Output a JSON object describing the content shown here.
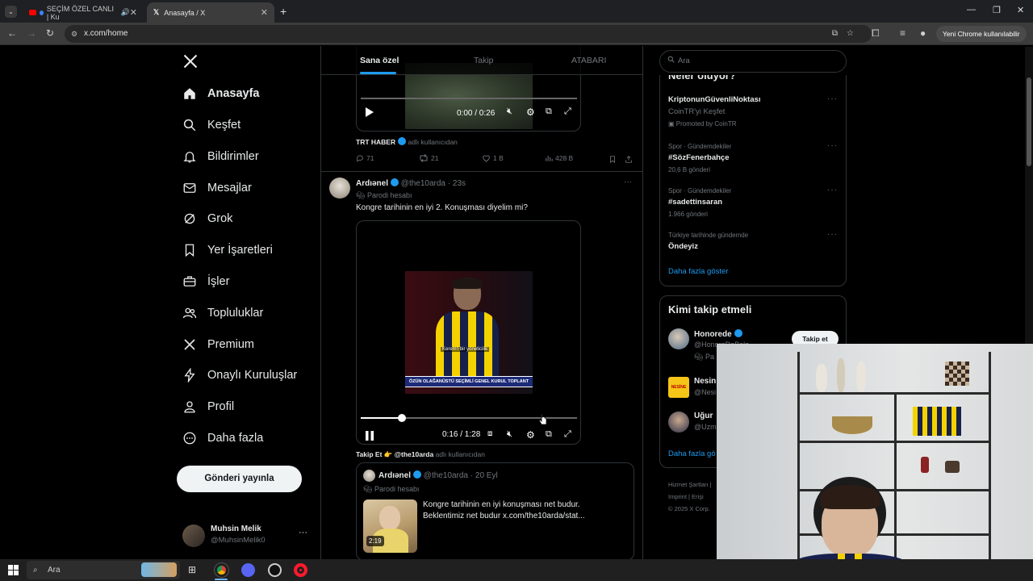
{
  "browser": {
    "tabs": [
      {
        "label": "SEÇİM ÖZEL CANLI | Ku",
        "active": false
      },
      {
        "label": "Anasayfa / X",
        "active": true
      }
    ],
    "url": "x.com/home",
    "chrome_button": "Yeni Chrome kullanılabilir"
  },
  "nav": {
    "items": [
      {
        "label": "Anasayfa",
        "icon": "home-icon"
      },
      {
        "label": "Keşfet",
        "icon": "search-icon"
      },
      {
        "label": "Bildirimler",
        "icon": "bell-icon"
      },
      {
        "label": "Mesajlar",
        "icon": "mail-icon"
      },
      {
        "label": "Grok",
        "icon": "grok-icon"
      },
      {
        "label": "Yer İşaretleri",
        "icon": "bookmark-icon"
      },
      {
        "label": "İşler",
        "icon": "briefcase-icon"
      },
      {
        "label": "Topluluklar",
        "icon": "people-icon"
      },
      {
        "label": "Premium",
        "icon": "x-logo-icon"
      },
      {
        "label": "Onaylı Kuruluşlar",
        "icon": "lightning-icon"
      },
      {
        "label": "Profil",
        "icon": "person-icon"
      },
      {
        "label": "Daha fazla",
        "icon": "more-circle-icon"
      }
    ],
    "post_button": "Gönderi yayınla",
    "account": {
      "name": "Muhsin Melik",
      "handle": "@MuhsinMelik0"
    }
  },
  "feed": {
    "tabs": [
      "Sana özel",
      "Takip",
      "ATABARI"
    ],
    "post1": {
      "video_time": "0:00 / 0:26",
      "source_name": "TRT HABER",
      "source_suffix": "adlı kullanıcıdan",
      "stats": {
        "replies": "71",
        "reposts": "21",
        "likes": "1 B",
        "views": "428 B"
      }
    },
    "post2": {
      "name": "Ardıənel",
      "handle": "@the10arda",
      "time": "· 23s",
      "label": "Parodi hesabı",
      "text": "Kongre tarihinin en iyi 2. Konuşması diyelim mi?",
      "video_time": "0:16 / 1:28",
      "video_progress": 0.19,
      "caption_small": "Kerem'i bir yöneticilik",
      "caption_banner": "ÖZÜN OLAĞANÜSTÜ SEÇİMLİ GENEL KURUL TOPLANT",
      "follow_line": "Takip Et 👉 @the10arda",
      "follow_suffix": "adlı kullanıcıdan",
      "quote": {
        "name": "Ardıənel",
        "handle": "@the10arda",
        "time": "· 20 Eyl",
        "label": "Parodi hesabı",
        "text1": "Kongre tarihinin en iyi konuşması net budur.",
        "text2": "Beklentimiz net budur  x.com/the10arda/stat...",
        "duration": "2:19"
      }
    }
  },
  "sidebar": {
    "search_placeholder": "Ara",
    "trends_title": "Neler oluyor?",
    "promo": {
      "title": "KriptonunGüvenliNoktası",
      "subtitle": "CoinTR'yi Keşfet",
      "promoted": "Promoted by CoinTR"
    },
    "trends": [
      {
        "category": "Spor · Gündemdekiler",
        "title": "#SözFenerbahçe",
        "count": "20,6 B gönderi"
      },
      {
        "category": "Spor · Gündemdekiler",
        "title": "#sadettinsaran",
        "count": "1.966 gönderi"
      },
      {
        "category": "Türkiye tarihinde gündemde",
        "title": "Öndeyiz",
        "count": ""
      }
    ],
    "show_more": "Daha fazla göster",
    "who_to_follow": "Kimi takip etmeli",
    "suggestions": [
      {
        "name": "Honorede",
        "handle": "@HonoreDeBalz",
        "extra": "Pa"
      },
      {
        "name": "Nesin",
        "handle": "@Nesi",
        "extra": ""
      },
      {
        "name": "Uğur",
        "handle": "@Uzm",
        "extra": ""
      }
    ],
    "follow_button": "Takip et",
    "more_link": "Daha fazla gö",
    "footer1": "Hizmet Şartları",
    "footer2": "Imprint",
    "footer2b": "Erişi",
    "footer3": "© 2025 X Corp."
  },
  "taskbar": {
    "search": "Ara"
  },
  "colors": {
    "accent": "#1d9bf0",
    "background": "#000000",
    "border": "#2f3336",
    "muted": "#71767b"
  }
}
